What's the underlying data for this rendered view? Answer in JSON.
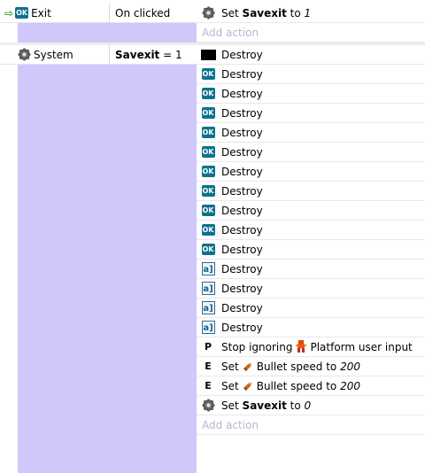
{
  "event1": {
    "object_name": "Exit",
    "condition": "On clicked",
    "actions": [
      {
        "icon": "gear-icon",
        "kind": "set",
        "prefix": "Set",
        "var": "Savexit",
        "middle": "to",
        "value": "1"
      }
    ],
    "add_action": "Add action"
  },
  "event2": {
    "object_name": "System",
    "cond_var": "Savexit",
    "cond_rest": "= 1",
    "actions": [
      {
        "icon": "black-box-icon",
        "text": "Destroy"
      },
      {
        "icon": "ok-button-icon",
        "text": "Destroy"
      },
      {
        "icon": "ok-button-icon",
        "text": "Destroy"
      },
      {
        "icon": "ok-button-icon",
        "text": "Destroy"
      },
      {
        "icon": "ok-button-icon",
        "text": "Destroy"
      },
      {
        "icon": "ok-button-icon",
        "text": "Destroy"
      },
      {
        "icon": "ok-button-icon",
        "text": "Destroy"
      },
      {
        "icon": "ok-button-icon",
        "text": "Destroy"
      },
      {
        "icon": "ok-button-icon",
        "text": "Destroy"
      },
      {
        "icon": "ok-button-icon",
        "text": "Destroy"
      },
      {
        "icon": "ok-button-icon",
        "text": "Destroy"
      },
      {
        "icon": "text-object-icon",
        "text": "Destroy"
      },
      {
        "icon": "text-object-icon",
        "text": "Destroy"
      },
      {
        "icon": "text-object-icon",
        "text": "Destroy"
      },
      {
        "icon": "text-object-icon",
        "text": "Destroy"
      },
      {
        "icon": "letter-p-icon",
        "letter": "P",
        "pre": "Stop ignoring",
        "obj_icon": "platform-sprite-icon",
        "post": "Platform user input"
      },
      {
        "icon": "letter-e-icon",
        "letter": "E",
        "pre": "Set",
        "obj_icon": "bullet-sprite-icon",
        "post": "Bullet speed to",
        "value": "200"
      },
      {
        "icon": "letter-e-icon",
        "letter": "E",
        "pre": "Set",
        "obj_icon": "bullet-sprite-icon",
        "post": "Bullet speed to",
        "value": "200"
      },
      {
        "icon": "gear-icon",
        "kind": "set",
        "prefix": "Set",
        "var": "Savexit",
        "middle": "to",
        "value": "0"
      }
    ],
    "add_action": "Add action"
  }
}
